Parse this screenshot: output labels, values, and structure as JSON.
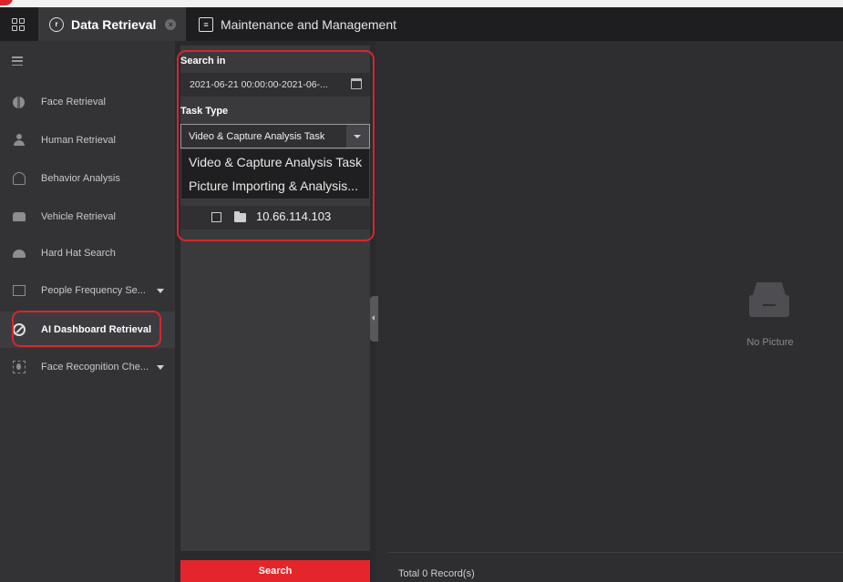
{
  "tabs": {
    "active_label": "Data Retrieval",
    "inactive_label": "Maintenance and Management"
  },
  "sidebar": {
    "items": [
      {
        "label": "Face Retrieval",
        "icon": "face-retrieval-icon"
      },
      {
        "label": "Human Retrieval",
        "icon": "human-icon"
      },
      {
        "label": "Behavior Analysis",
        "icon": "behavior-icon"
      },
      {
        "label": "Vehicle Retrieval",
        "icon": "vehicle-icon"
      },
      {
        "label": "Hard Hat Search",
        "icon": "hard-hat-icon"
      },
      {
        "label": "People Frequency Se...",
        "icon": "chart-icon",
        "expandable": true
      },
      {
        "label": "AI Dashboard Retrieval",
        "icon": "ai-dashboard-icon",
        "selected": true
      },
      {
        "label": "Face Recognition Che...",
        "icon": "face-recognition-icon",
        "expandable": true
      }
    ]
  },
  "filter": {
    "search_in_label": "Search in",
    "date_range": "2021-06-21 00:00:00-2021-06-...",
    "task_type_label": "Task Type",
    "task_type_selected": "Video & Capture Analysis Task",
    "dropdown_options": [
      "Video & Capture Analysis Task",
      "Picture Importing & Analysis..."
    ],
    "device": "10.66.114.103",
    "search_button": "Search"
  },
  "results": {
    "empty_text": "No Picture",
    "total_records": "Total 0 Record(s)"
  },
  "colors": {
    "accent_red": "#e4262c",
    "highlight_outline": "#d6262d",
    "background": "#2d2d30"
  }
}
